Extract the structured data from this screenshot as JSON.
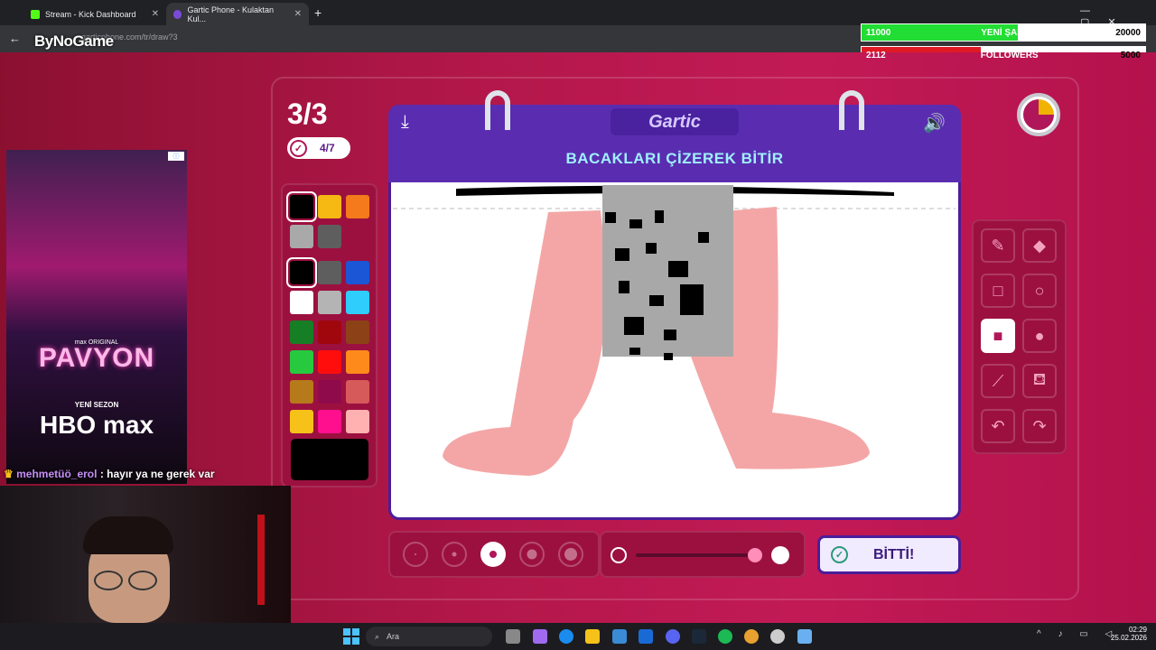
{
  "browser": {
    "tabs": [
      {
        "label": "Stream - Kick Dashboard",
        "icon": "kick-icon"
      },
      {
        "label": "Gartic Phone - Kulaktan Kul...",
        "icon": "gartic-icon"
      }
    ],
    "url": "garticphone.com/tr/draw?3"
  },
  "stream_overlay": {
    "logo": "ByNoGame",
    "stats": [
      {
        "current": "11000",
        "label": "YENİ ŞARKI",
        "target": "20000",
        "color": "#22dd33",
        "fraction": 0.55
      },
      {
        "current": "2112",
        "label": "FOLLOWERS",
        "target": "5000",
        "color": "#e01a24",
        "fraction": 0.42
      }
    ]
  },
  "game": {
    "round": "3/3",
    "progress": "4/7",
    "brand": "Gartic",
    "prompt": "BACAKLARI ÇİZEREK BİTİR",
    "done_label": "BİTTİ!",
    "timer_fraction": 0.25,
    "palette_colors": [
      "#000000",
      "#f6b813",
      "#f47a1c",
      "#a9a9a9",
      "#5e5e5e",
      "#000000",
      "#5e5e5e",
      "#1a56d6",
      "#ffffff",
      "#b4b4b4",
      "#2fcdfb",
      "#167e24",
      "#a0070d",
      "#8c4216",
      "#27c93f",
      "#ff0d0d",
      "#ff8a1c",
      "#b67a1a",
      "#8f0a4a",
      "#d65a5a",
      "#f6c21a",
      "#ff0f8e",
      "#ffb0b0"
    ],
    "current_color": "#000000",
    "tools": [
      "pencil-icon",
      "eraser-icon",
      "rectangle-outline-icon",
      "circle-outline-icon",
      "rectangle-fill-icon",
      "circle-fill-icon",
      "line-icon",
      "fill-bucket-icon",
      "undo-icon",
      "redo-icon"
    ],
    "selected_tool": "rectangle-fill-icon",
    "brush_sizes": 5,
    "selected_size": 3
  },
  "ad": {
    "brand_line": "max ORIGINAL",
    "title": "PAVYON",
    "subtitle": "YENİ SEZON",
    "logo": "HBO max"
  },
  "chat": {
    "user": "mehmetüö_erol",
    "message": ": hayır ya ne gerek var"
  },
  "taskbar": {
    "search_placeholder": "Ara",
    "time": "02:29",
    "date": "25.02.2026"
  }
}
